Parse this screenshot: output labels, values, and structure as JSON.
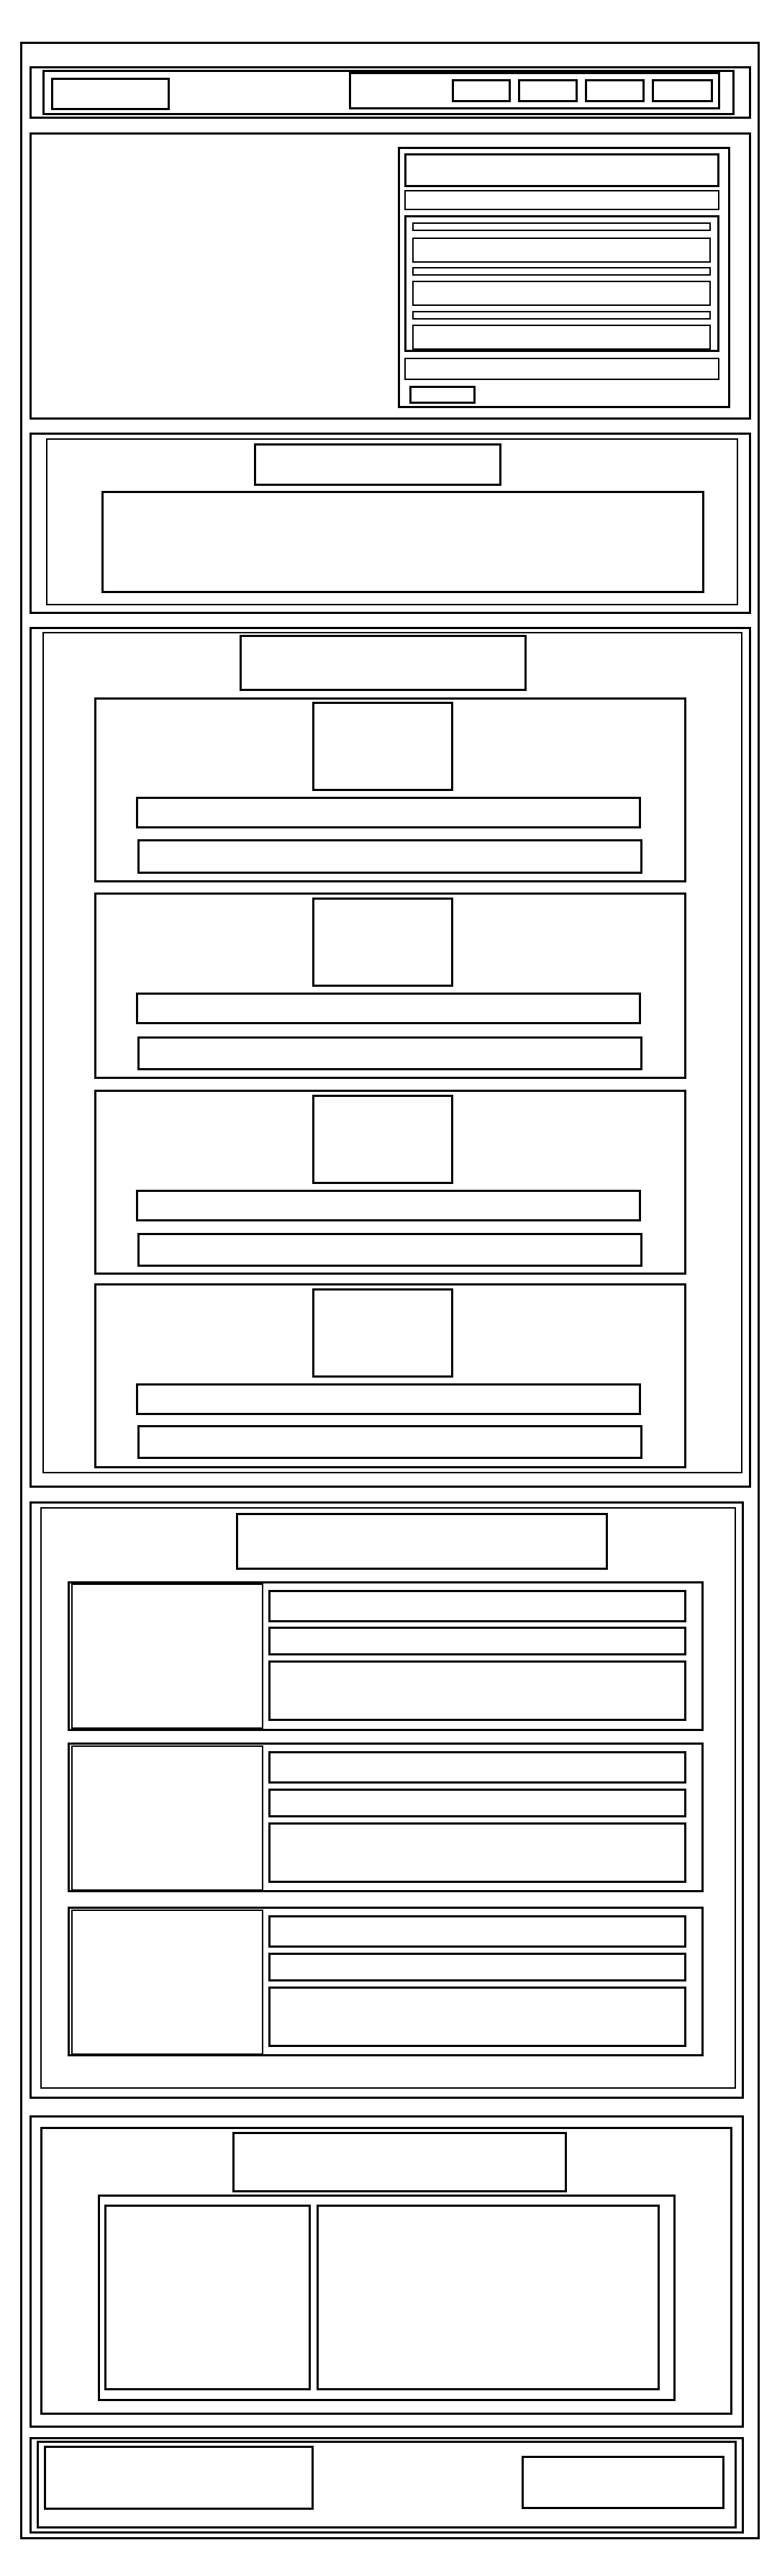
{
  "colors": {
    "line": "#000000",
    "background": "#ffffff"
  },
  "header": {
    "nav_items": [
      "",
      "",
      "",
      ""
    ]
  },
  "hero": {
    "form": {
      "fields": [
        "",
        "",
        "",
        "",
        "",
        "",
        "",
        "",
        ""
      ],
      "submit_label": ""
    }
  },
  "section_intro": {
    "heading": "",
    "text": ""
  },
  "section_cards": {
    "heading": "",
    "cards": [
      {
        "title": "",
        "text": ""
      },
      {
        "title": "",
        "text": ""
      },
      {
        "title": "",
        "text": ""
      },
      {
        "title": "",
        "text": ""
      }
    ]
  },
  "section_list": {
    "heading": "",
    "items": [
      {
        "title": "",
        "subtitle": "",
        "text": ""
      },
      {
        "title": "",
        "subtitle": "",
        "text": ""
      },
      {
        "title": "",
        "subtitle": "",
        "text": ""
      }
    ]
  },
  "section_feature": {
    "heading": "",
    "text": ""
  },
  "footer": {
    "left_text": "",
    "right_text": ""
  }
}
